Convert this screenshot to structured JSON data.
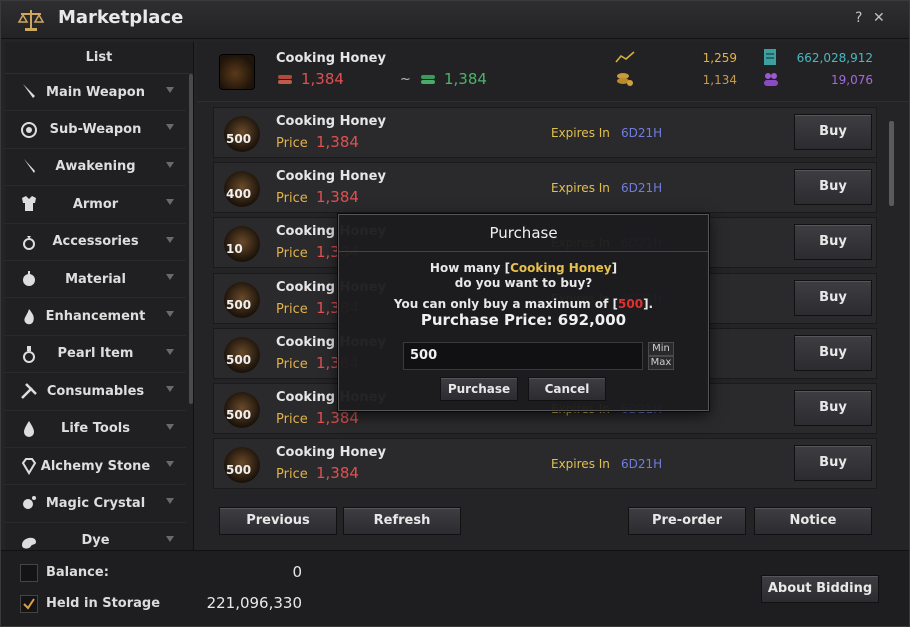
{
  "window": {
    "title": "Marketplace",
    "help_label": "?",
    "close_label": "✕"
  },
  "sidebar": {
    "header": "List",
    "items": [
      {
        "label": "Main Weapon",
        "icon": "sword-icon"
      },
      {
        "label": "Sub-Weapon",
        "icon": "shield-icon"
      },
      {
        "label": "Awakening",
        "icon": "blade-icon"
      },
      {
        "label": "Armor",
        "icon": "armor-icon"
      },
      {
        "label": "Accessories",
        "icon": "ring-icon"
      },
      {
        "label": "Material",
        "icon": "material-icon"
      },
      {
        "label": "Enhancement",
        "icon": "flame-icon"
      },
      {
        "label": "Pearl Item",
        "icon": "potion-icon"
      },
      {
        "label": "Consumables",
        "icon": "tools-icon"
      },
      {
        "label": "Life Tools",
        "icon": "drop-icon"
      },
      {
        "label": "Alchemy Stone",
        "icon": "gem-icon"
      },
      {
        "label": "Magic Crystal",
        "icon": "crystal-icon"
      },
      {
        "label": "Dye",
        "icon": "palette-icon"
      }
    ]
  },
  "summary": {
    "name": "Cooking Honey",
    "min_price": "1,384",
    "tilde": "~",
    "max_price": "1,384",
    "stat1": "1,259",
    "stat2": "662,028,912",
    "stat3": "1,134",
    "stat4": "19,076"
  },
  "listings": [
    {
      "qty": "500",
      "name": "Cooking Honey",
      "price_label": "Price",
      "price": "1,384",
      "expires_label": "Expires In",
      "expires": "6D21H",
      "buy_label": "Buy"
    },
    {
      "qty": "400",
      "name": "Cooking Honey",
      "price_label": "Price",
      "price": "1,384",
      "expires_label": "Expires In",
      "expires": "6D21H",
      "buy_label": "Buy"
    },
    {
      "qty": "10",
      "name": "Cooking Honey",
      "price_label": "Price",
      "price": "1,384",
      "expires_label": "Expires In",
      "expires": "6D21H",
      "buy_label": "Buy"
    },
    {
      "qty": "500",
      "name": "Cooking Honey",
      "price_label": "Price",
      "price": "1,384",
      "expires_label": "Expires In",
      "expires": "6D21H",
      "buy_label": "Buy"
    },
    {
      "qty": "500",
      "name": "Cooking Honey",
      "price_label": "Price",
      "price": "1,384",
      "expires_label": "Expires In",
      "expires": "6D21H",
      "buy_label": "Buy"
    },
    {
      "qty": "500",
      "name": "Cooking Honey",
      "price_label": "Price",
      "price": "1,384",
      "expires_label": "Expires In",
      "expires": "6D21H",
      "buy_label": "Buy"
    },
    {
      "qty": "500",
      "name": "Cooking Honey",
      "price_label": "Price",
      "price": "1,384",
      "expires_label": "Expires In",
      "expires": "6D21H",
      "buy_label": "Buy"
    }
  ],
  "nav": {
    "previous_label": "Previous",
    "refresh_label": "Refresh",
    "preorder_label": "Pre-order",
    "notice_label": "Notice"
  },
  "bottom": {
    "balance_label": "Balance:",
    "balance_value": "0",
    "storage_label": "Held in Storage",
    "storage_value": "221,096,330",
    "storage_checked": true,
    "about_bidding_label": "About Bidding"
  },
  "modal": {
    "title": "Purchase",
    "line1_prefix": "How many [",
    "line1_item": "Cooking Honey",
    "line1_suffix": "]",
    "line2": "do you want to buy?",
    "line3_prefix": "You can only buy a maximum of [",
    "line3_max": "500",
    "line3_suffix": "].",
    "price_text": "Purchase Price: 692,000",
    "quantity_value": "500",
    "min_label": "Min",
    "max_label": "Max",
    "purchase_label": "Purchase",
    "cancel_label": "Cancel"
  },
  "colors": {
    "price_red": "#e05050",
    "price_green": "#4db36a",
    "label_gold": "#e2b24a",
    "time_blue": "#6f7de0"
  }
}
